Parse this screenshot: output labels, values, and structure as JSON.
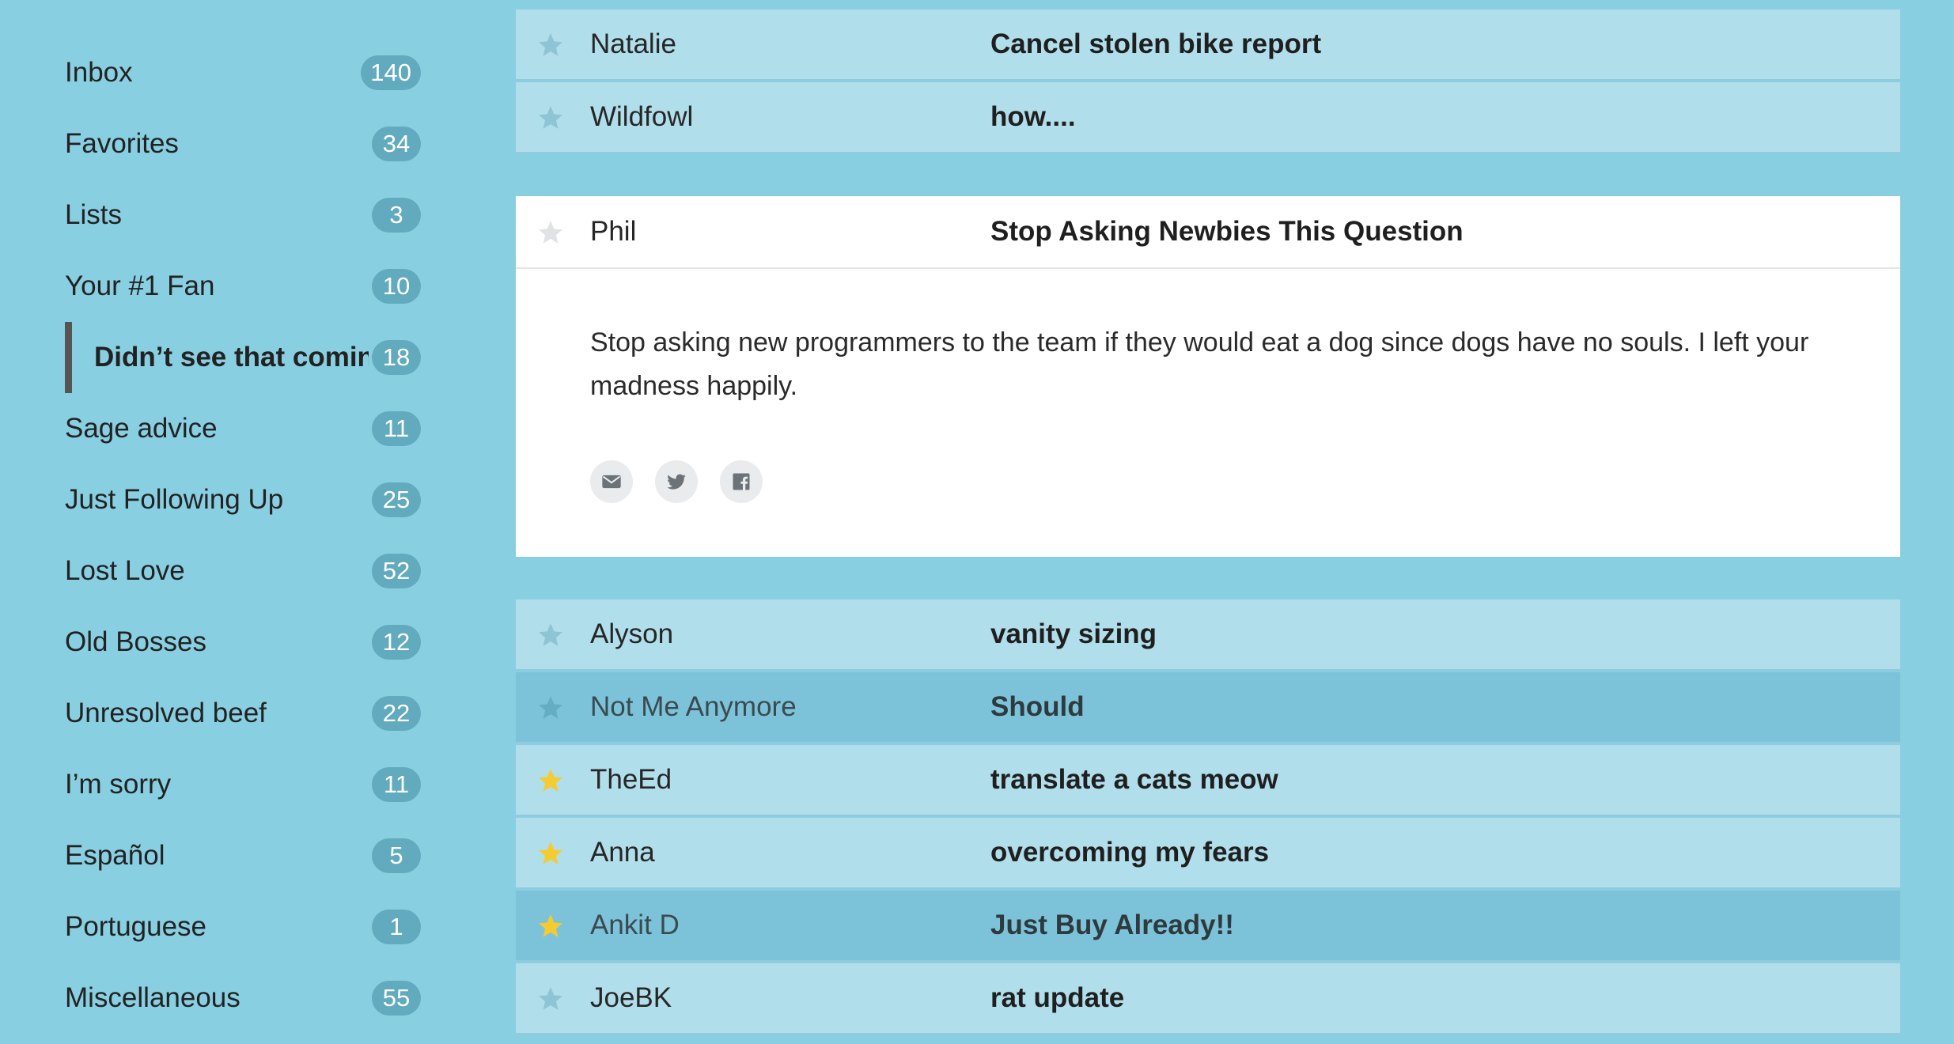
{
  "sidebar": {
    "items": [
      {
        "label": "Inbox",
        "count": "140"
      },
      {
        "label": "Favorites",
        "count": "34"
      },
      {
        "label": "Lists",
        "count": "3"
      },
      {
        "label": "Your #1 Fan",
        "count": "10"
      },
      {
        "label": "Didn’t see that coming",
        "count": "18",
        "active": true
      },
      {
        "label": "Sage advice",
        "count": "11"
      },
      {
        "label": "Just Following Up",
        "count": "25"
      },
      {
        "label": "Lost Love",
        "count": "52"
      },
      {
        "label": "Old Bosses",
        "count": "12"
      },
      {
        "label": "Unresolved beef",
        "count": "22"
      },
      {
        "label": "I’m sorry",
        "count": "11"
      },
      {
        "label": "Español",
        "count": "5"
      },
      {
        "label": "Portuguese",
        "count": "1"
      },
      {
        "label": "Miscellaneous",
        "count": "55"
      }
    ]
  },
  "messages_top": [
    {
      "sender": "Natalie",
      "subject": "Cancel stolen bike report",
      "starred": false
    },
    {
      "sender": "Wildfowl",
      "subject": "how....",
      "starred": false
    }
  ],
  "open_message": {
    "sender": "Phil",
    "subject": "Stop Asking Newbies This Question",
    "starred": false,
    "body": "Stop asking new programmers to the team if they would eat a dog since dogs have no souls. I left your madness happily.",
    "share_icons": [
      "mail-icon",
      "twitter-icon",
      "facebook-icon"
    ]
  },
  "messages_bottom": [
    {
      "sender": "Alyson",
      "subject": "vanity sizing",
      "starred": false,
      "highlighted": false
    },
    {
      "sender": "Not Me Anymore",
      "subject": "Should",
      "starred": false,
      "highlighted": true
    },
    {
      "sender": "TheEd",
      "subject": "translate a cats meow",
      "starred": true,
      "highlighted": false
    },
    {
      "sender": "Anna",
      "subject": "overcoming my fears",
      "starred": true,
      "highlighted": false
    },
    {
      "sender": "Ankit D",
      "subject": "Just Buy Already!!",
      "starred": true,
      "highlighted": true
    },
    {
      "sender": "JoeBK",
      "subject": "rat update",
      "starred": false,
      "highlighted": false
    }
  ],
  "colors": {
    "background": "#89cfe2",
    "row": "#b1deeb",
    "row_highlight": "#7cc3da",
    "badge": "#62aabd",
    "star_on": "#f5cb32",
    "star_off_row": "#8ec4d3",
    "star_off_card": "#dfe3e6"
  }
}
